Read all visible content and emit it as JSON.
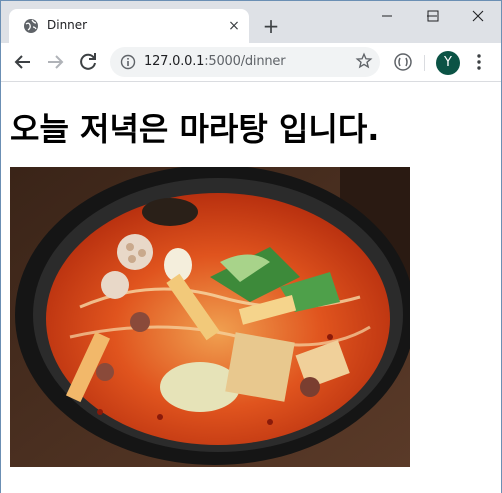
{
  "tab": {
    "title": "Dinner",
    "close_glyph": "×",
    "newtab_glyph": "+"
  },
  "window_controls": {
    "minimize": "—",
    "maximize": "☐",
    "close": "✕"
  },
  "toolbar": {
    "url_host": "127.0.0.1",
    "url_path": ":5000/dinner",
    "avatar_letter": "Y"
  },
  "page": {
    "heading": "오늘 저녁은 마라탕 입니다."
  },
  "icons": [
    "globe-icon",
    "close-icon",
    "plus-icon",
    "back-arrow-icon",
    "forward-arrow-icon",
    "reload-icon",
    "info-icon",
    "star-icon",
    "extension-icon",
    "kebab-menu-icon"
  ],
  "colors": {
    "tabstrip": "#dee1e6",
    "omnibox": "#f1f3f4",
    "avatar": "#0b5345"
  }
}
